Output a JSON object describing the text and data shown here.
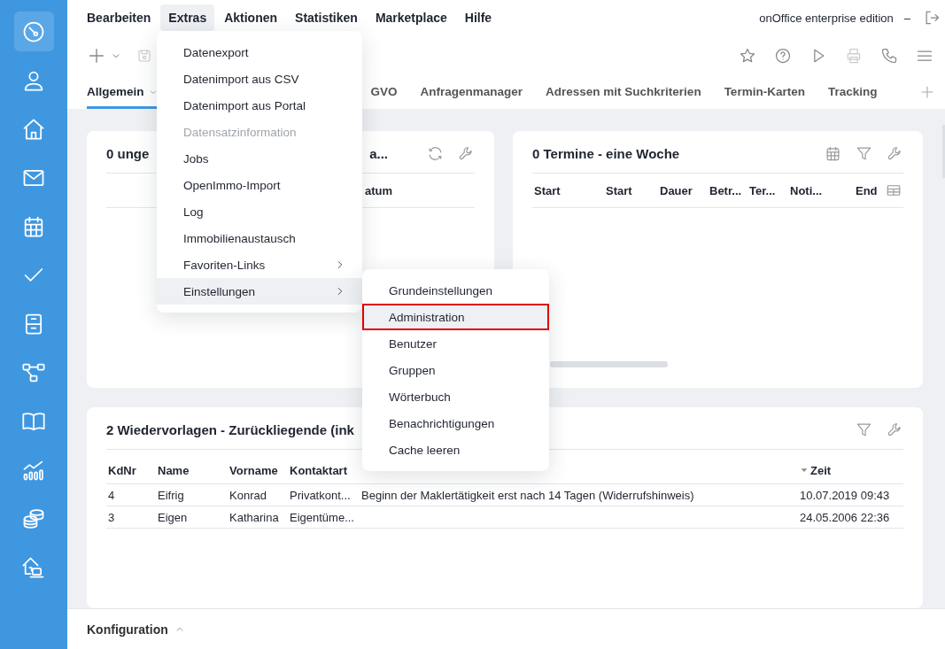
{
  "sidebar": {
    "items": [
      {
        "selected": true
      },
      {
        "selected": false
      },
      {
        "selected": false
      },
      {
        "selected": false
      },
      {
        "selected": false
      },
      {
        "selected": false
      },
      {
        "selected": false
      },
      {
        "selected": false
      },
      {
        "selected": false
      },
      {
        "selected": false
      },
      {
        "selected": false
      },
      {
        "selected": false
      }
    ]
  },
  "menubar": {
    "items": [
      {
        "label": "Bearbeiten",
        "selected": false
      },
      {
        "label": "Extras",
        "selected": true
      },
      {
        "label": "Aktionen",
        "selected": false
      },
      {
        "label": "Statistiken",
        "selected": false
      },
      {
        "label": "Marketplace",
        "selected": false
      },
      {
        "label": "Hilfe",
        "selected": false
      }
    ]
  },
  "header": {
    "product": "onOffice enterprise edition",
    "separator": "–"
  },
  "tabs": [
    {
      "label": "Allgemein",
      "selected": true,
      "dropdown": true
    },
    {
      "label": "GVO",
      "selected": false,
      "dropdown": false
    },
    {
      "label": "Anfragenmanager",
      "selected": false,
      "dropdown": false
    },
    {
      "label": "Adressen mit Suchkriterien",
      "selected": false,
      "dropdown": false
    },
    {
      "label": "Termin-Karten",
      "selected": false,
      "dropdown": false
    },
    {
      "label": "Tracking",
      "selected": false,
      "dropdown": false
    }
  ],
  "tasks_card": {
    "title": "0 unge",
    "title_tail": "a...",
    "column_tail": "atum"
  },
  "appointments_card": {
    "title": "0 Termine - eine Woche",
    "columns": [
      "Start",
      "Start",
      "Dauer",
      "Betr...",
      "Ter...",
      "Noti...",
      "End"
    ]
  },
  "followups_card": {
    "title": "2 Wiedervorlagen - Zurückliegende (ink",
    "columns": [
      {
        "label": "KdNr",
        "sorted": false
      },
      {
        "label": "Name",
        "sorted": false
      },
      {
        "label": "Vorname",
        "sorted": false
      },
      {
        "label": "Kontaktart",
        "sorted": false
      },
      {
        "label": "Zeit",
        "sorted": true
      }
    ],
    "rows": [
      {
        "kdnr": "4",
        "name": "Eifrig",
        "vorname": "Konrad",
        "kontaktart": "Privatkont...",
        "wiedervorlage": "Beginn der Maklertätigkeit erst nach 14 Tagen (Widerrufshinweis)",
        "zeit": "10.07.2019 09:43"
      },
      {
        "kdnr": "3",
        "name": "Eigen",
        "vorname": "Katharina",
        "kontaktart": "Eigentüme...",
        "zeit": "24.05.2006 22:36"
      }
    ]
  },
  "extras_menu": {
    "items": [
      {
        "label": "Datenexport",
        "disabled": false,
        "submenu": false,
        "selected": false
      },
      {
        "label": "Datenimport aus CSV",
        "disabled": false,
        "submenu": false,
        "selected": false
      },
      {
        "label": "Datenimport aus Portal",
        "disabled": false,
        "submenu": false,
        "selected": false
      },
      {
        "label": "Datensatzinformation",
        "disabled": true,
        "submenu": false,
        "selected": false
      },
      {
        "label": "Jobs",
        "disabled": false,
        "submenu": false,
        "selected": false
      },
      {
        "label": "OpenImmo-Import",
        "disabled": false,
        "submenu": false,
        "selected": false
      },
      {
        "label": "Log",
        "disabled": false,
        "submenu": false,
        "selected": false
      },
      {
        "label": "Immobilienaustausch",
        "disabled": false,
        "submenu": false,
        "selected": false
      },
      {
        "label": "Favoriten-Links",
        "disabled": false,
        "submenu": true,
        "selected": false
      },
      {
        "label": "Einstellungen",
        "disabled": false,
        "submenu": true,
        "selected": true
      }
    ]
  },
  "settings_submenu": {
    "items": [
      {
        "label": "Grundeinstellungen",
        "selected": false,
        "outlined": false
      },
      {
        "label": "Administration",
        "selected": true,
        "outlined": true
      },
      {
        "label": "Benutzer",
        "selected": false,
        "outlined": false
      },
      {
        "label": "Gruppen",
        "selected": false,
        "outlined": false
      },
      {
        "label": "Wörterbuch",
        "selected": false,
        "outlined": false
      },
      {
        "label": "Benachrichtigungen",
        "selected": false,
        "outlined": false
      },
      {
        "label": "Cache leeren",
        "selected": false,
        "outlined": false
      }
    ]
  },
  "footer": {
    "label": "Konfiguration",
    "expanded": false
  }
}
